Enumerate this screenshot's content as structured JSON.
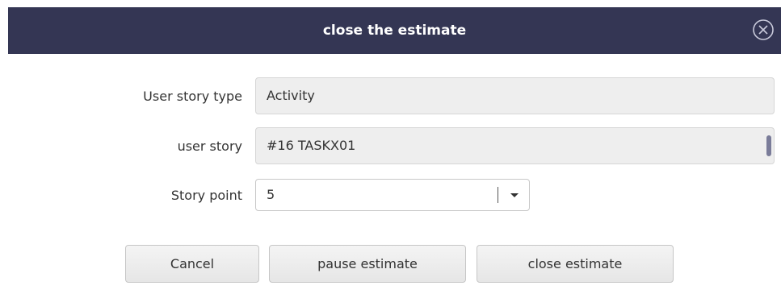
{
  "dialog": {
    "title": "close the estimate",
    "close_icon": "close-circle-icon"
  },
  "form": {
    "story_type_label": "User story type",
    "story_type_value": "Activity",
    "story_label": "user story",
    "story_value": "#16 TASKX01",
    "story_point_label": "Story point",
    "story_point_value": "5"
  },
  "actions": {
    "cancel_label": "Cancel",
    "pause_label": "pause estimate",
    "close_label": "close estimate"
  },
  "colors": {
    "titlebar": "#343654",
    "title_text": "#ffffff",
    "field_bg": "#eeeeee"
  }
}
